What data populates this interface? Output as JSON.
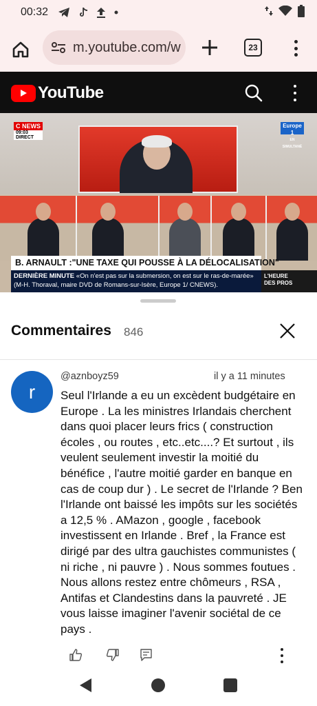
{
  "status_bar": {
    "time": "00:32",
    "icons": [
      "telegram-icon",
      "tiktok-icon",
      "upload-icon",
      "dot-icon"
    ],
    "right_icons": [
      "data-arrows-icon",
      "wifi-icon",
      "battery-icon"
    ]
  },
  "browser": {
    "url": "m.youtube.com/w",
    "tab_count": "23"
  },
  "youtube": {
    "logo_text": "YouTube"
  },
  "video": {
    "channel_logo_line1": "C NEWS",
    "channel_logo_line2": "09:03 DIRECT",
    "partner_logo": "Europe 1",
    "partner_sub": "EN SIMULTANÉ",
    "headline": "B. ARNAULT :\"UNE TAXE QUI POUSSE À LA DÉLOCALISATION\"",
    "ticker_label": "DERNIÈRE MINUTE",
    "ticker_text": "«On n'est pas sur la submersion, on est sur le ras-de-marée» (M-H. Thoraval, maire DVD de Romans-sur-Isère, Europe 1/ CNEWS).",
    "program_line1": "L'HEURE",
    "program_line2": "DES PROS"
  },
  "comments": {
    "title": "Commentaires",
    "count": "846",
    "items": [
      {
        "avatar_letter": "r",
        "author": "@aznboyz59",
        "time": "il y a 11 minutes",
        "text": "Seul l'Irlande a eu un excèdent budgétaire en Europe . La les ministres Irlandais cherchent dans quoi placer leurs frics ( construction écoles , ou routes , etc..etc....? Et surtout , ils veulent seulement investir la moitié du bénéfice , l'autre moitié garder en banque en cas de coup dur ) . Le secret de l'Irlande ? Ben l'Irlande ont baissé les impôts sur les sociétés a 12,5 % . AMazon , google , facebook investissent en Irlande . Bref , la France est dirigé par des ultra gauchistes communistes ( ni riche , ni pauvre ) . Nous sommes foutues . Nous allons restez entre chômeurs , RSA , Antifas et Clandestins dans la pauvreté . JE vous laisse imaginer l'avenir sociétal de ce pays ."
      }
    ]
  },
  "colors": {
    "browser_bg": "#fcefef",
    "youtube_red": "#ff0000",
    "avatar_blue": "#1565c0"
  }
}
